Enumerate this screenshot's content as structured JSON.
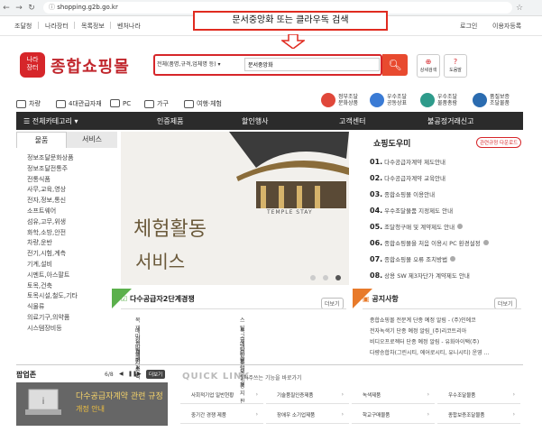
{
  "browser": {
    "url": "shopping.g2b.go.kr"
  },
  "util_bar": {
    "left_links": [
      "조달청",
      "나라장터",
      "목록정보",
      "벤처나라"
    ],
    "right_links": [
      "로그인",
      "이용자등록"
    ]
  },
  "annotation": {
    "text": "문서중앙화 또는 클라우독 검색"
  },
  "logo": {
    "badge": "나라\n장터",
    "text": "종합쇼핑몰"
  },
  "search": {
    "select": "전체(품명,규격,업체명 등)",
    "value": "문서중앙화",
    "btn_detail": "상세검색",
    "btn_help": "도움말"
  },
  "categories": [
    "차량",
    "4대관급자재",
    "PC",
    "가구",
    "여행·체험"
  ],
  "certs": [
    {
      "label": "정부조달\n문화상품",
      "color": "#e0473a"
    },
    {
      "label": "우수조달\n공동상표",
      "color": "#3a7bd5"
    },
    {
      "label": "우수조달\n물품총람",
      "color": "#2e9b8b"
    },
    {
      "label": "품질보증\n조달물품",
      "color": "#2b6cb0"
    }
  ],
  "dark_nav": {
    "all_category": "전체카테고리",
    "items": [
      "인증제품",
      "할인행사",
      "고객센터",
      "불공정거래신고"
    ]
  },
  "left_panel": {
    "tabs": [
      "물품",
      "서비스"
    ],
    "items": [
      "정보조달문화상품",
      "정보조달전통주",
      "전통식품",
      "사무,교육,영상",
      "전자,정보,통신",
      "소프트웨어",
      "섬유,고무,위생",
      "화학,소방,안전",
      "차량,운반",
      "전기,시험,계측",
      "기계,설비",
      "시멘트,아스팔트",
      "토목,건축",
      "토목시설,철도,기타",
      "식물류",
      "의료기구,의약품",
      "시스템장비등"
    ]
  },
  "banner": {
    "text1": "체험활동",
    "text2": "서비스",
    "sub": "TEMPLE STAY"
  },
  "shopping_guide": {
    "title": "쇼핑도우미",
    "btn": "관련규정 다운로드",
    "items": [
      {
        "num": "01.",
        "text": "다수공급자계약 제도안내",
        "chk": false
      },
      {
        "num": "02.",
        "text": "다수공급자계약 교육안내",
        "chk": false
      },
      {
        "num": "03.",
        "text": "종합쇼핑몰 이용안내",
        "chk": false
      },
      {
        "num": "04.",
        "text": "우수조달물품 지정제도 안내",
        "chk": false
      },
      {
        "num": "05.",
        "text": "조달청구매 및 계약제도 안내",
        "chk": true
      },
      {
        "num": "06.",
        "text": "종합쇼핑몰을 처음 이용시 PC 환경설정",
        "chk": true
      },
      {
        "num": "07.",
        "text": "종합쇼핑몰 오류 조치방법",
        "chk": true
      },
      {
        "num": "08.",
        "text": "상용 SW 제3자단가 계약제도 안내",
        "chk": false
      }
    ]
  },
  "supplier": {
    "title": "다수공급자2단계경쟁",
    "more": "더보기",
    "items": [
      "목재마루재외 1종",
      "배전반외 2종",
      "외벽패널",
      "클라스틱그레이팅",
      "스틸그레이팅",
      "특수위반등외 1종",
      "새탁물건조기",
      "도로영구표지판"
    ]
  },
  "notice": {
    "title": "공지사항",
    "more": "더보기",
    "items": [
      "종합쇼핑몰 전문계 단종 예정 알림 - (주)인에코",
      "전자녹색기 단종 예정 알림_(주)리코트리아",
      "비디오프로젝터 단종 예정 알림 - 유화아이택(주)",
      "다량승합차(그린시티, 에어로시티, 유니시티) 운영 ..."
    ]
  },
  "popup_zone": {
    "title": "팝업존",
    "page": "6/8",
    "more": "더보기",
    "line1": "다수공급자계약 관련 규정",
    "line2": "개정 안내"
  },
  "quick_link": {
    "title": "QUICK LINK",
    "subtitle": "자주쓰는 기능을 바로가기",
    "cells": [
      "사회적기업 일반현황",
      "기술품질인증제품",
      "녹색제품",
      "우수조달물품",
      "중기간 경쟁 제품",
      "장애우 소기업제품",
      "학교구매물품",
      "종합보증조달물품"
    ]
  }
}
